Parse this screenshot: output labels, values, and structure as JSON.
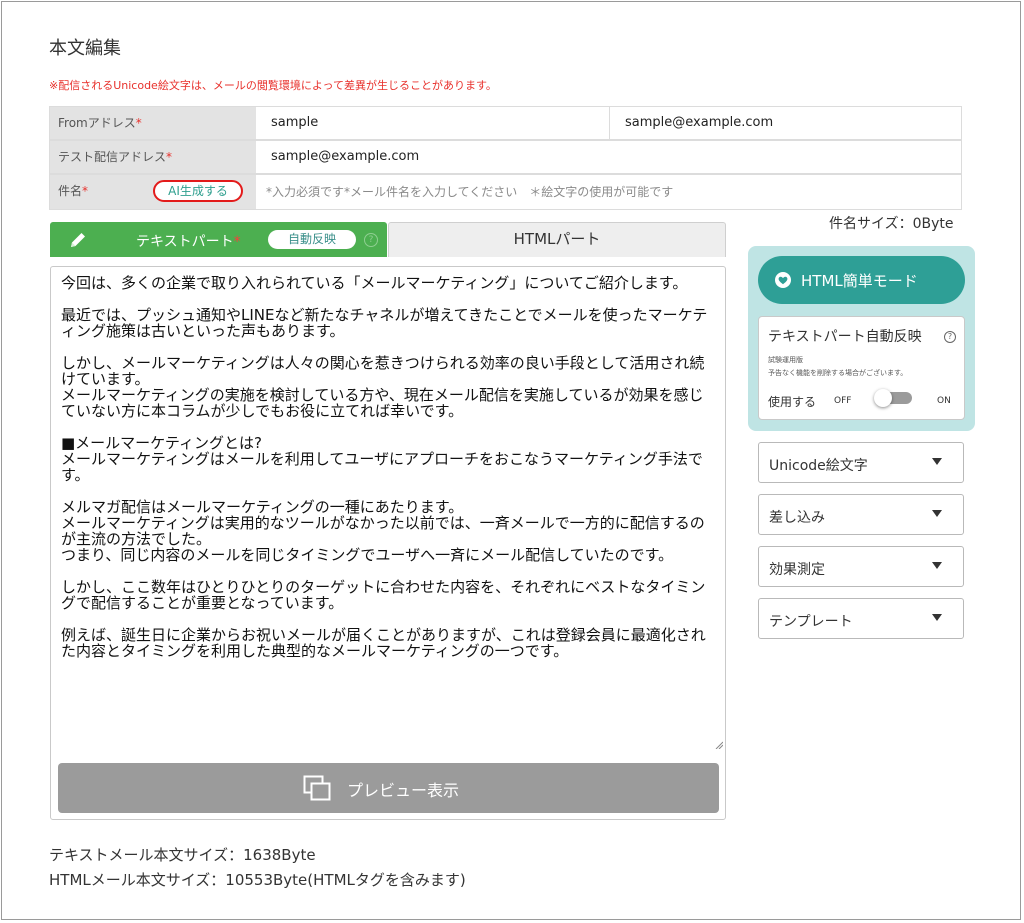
{
  "page_title": "本文編集",
  "notice": "※配信されるUnicode絵文字は、メールの閲覧環境によって差異が生じることがあります。",
  "header": {
    "from": {
      "label": "Fromアドレス",
      "required": "*",
      "name": "sample",
      "email": "sample@example.com"
    },
    "test": {
      "label": "テスト配信アドレス",
      "required": "*",
      "value": "sample@example.com"
    },
    "subject": {
      "label": "件名",
      "required": "*",
      "ai_button": "AI生成する",
      "placeholder": "*入力必須です*メール件名を入力してください　＊絵文字の使用が可能です",
      "value": ""
    }
  },
  "subject_size": "件名サイズ：0Byte",
  "tabs": {
    "text": {
      "label": "テキストパート",
      "required": "*",
      "badge": "自動反映",
      "help": "?",
      "icon": "pencil-icon"
    },
    "html": {
      "label": "HTMLパート"
    }
  },
  "body_text": "今回は、多くの企業で取り入れられている「メールマーケティング」についてご紹介します。\n\n最近では、プッシュ通知やLINEなど新たなチャネルが増えてきたことでメールを使ったマーケティング施策は古いといった声もあります。\n\nしかし、メールマーケティングは人々の関心を惹きつけられる効率の良い手段として活用され続けています。\nメールマーケティングの実施を検討している方や、現在メール配信を実施しているが効果を感じていない方に本コラムが少しでもお役に立てれば幸いです。\n\n■メールマーケティングとは?\nメールマーケティングはメールを利用してユーザにアプローチをおこなうマーケティング手法です。\n\nメルマガ配信はメールマーケティングの一種にあたります。\nメールマーケティングは実用的なツールがなかった以前では、一斉メールで一方的に配信するのが主流の方法でした。\nつまり、同じ内容のメールを同じタイミングでユーザへ一斉にメール配信していたのです。\n\nしかし、ここ数年はひとりひとりのターゲットに合わせた内容を、それぞれにベストなタイミングで配信することが重要となっています。\n\n例えば、誕生日に企業からお祝いメールが届くことがありますが、これは登録会員に最適化された内容とタイミングを利用した典型的なメールマーケティングの一つです。",
  "preview_button": {
    "label": "プレビュー表示",
    "icon": "preview-icon"
  },
  "footer": {
    "text_size": "テキストメール本文サイズ：1638Byte",
    "html_size": "HTMLメール本文サイズ：10553Byte(HTMLタグを含みます)"
  },
  "side": {
    "easy_mode": {
      "label": "HTML簡単モード",
      "icon": "heart-icon"
    },
    "auto_reflect": {
      "title": "テキストパート自動反映",
      "help": "?",
      "note1": "試験運用版",
      "note2": "予告なく機能を削除する場合がございます。",
      "use_label": "使用する",
      "off": "OFF",
      "on": "ON",
      "enabled": false
    },
    "dropdowns": [
      {
        "label": "Unicode絵文字"
      },
      {
        "label": "差し込み"
      },
      {
        "label": "効果測定"
      },
      {
        "label": "テンプレート"
      }
    ]
  },
  "colors": {
    "accent_green": "#4caf50",
    "teal": "#2e9f96",
    "panel_bg": "#bfe4e4",
    "required_red": "#e8312c",
    "highlight_ring": "#e31b1b"
  }
}
